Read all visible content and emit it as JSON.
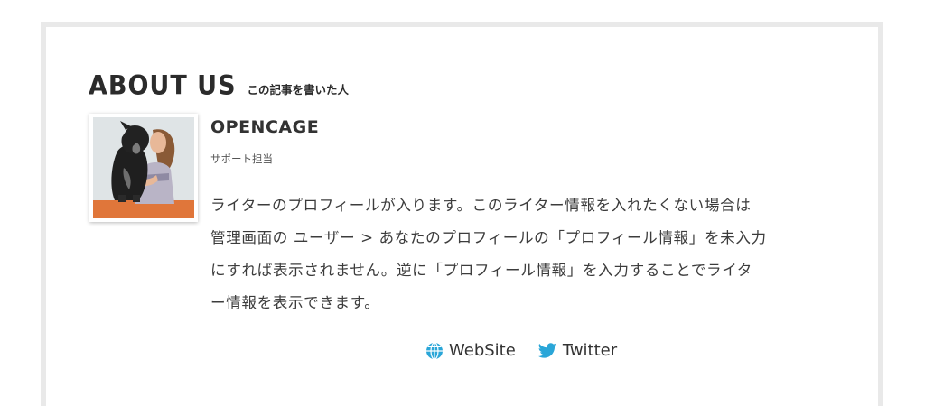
{
  "about": {
    "title": "ABOUT US",
    "subtitle": "この記事を書いた人"
  },
  "author": {
    "name": "OPENCAGE",
    "role": "サポート担当",
    "avatar_icon": "author-photo"
  },
  "bio": {
    "lines": [
      "ライターのプロフィールが入ります。このライター情報を入れたくない場合は",
      "管理画面の ユーザー > あなたのプロフィールの「プロフィール情報」を未入力",
      "にすれば表示されません。逆に「プロフィール情報」を入力することでライタ",
      "ー情報を表示できます。"
    ]
  },
  "links": [
    {
      "label": "WebSite",
      "icon": "globe-icon",
      "color": "#2aa6d8"
    },
    {
      "label": "Twitter",
      "icon": "twitter-bird-icon",
      "color": "#2aa6d8"
    }
  ],
  "colors": {
    "border": "#e9e9e9",
    "text": "#3c3c3c",
    "accent": "#2aa6d8"
  }
}
